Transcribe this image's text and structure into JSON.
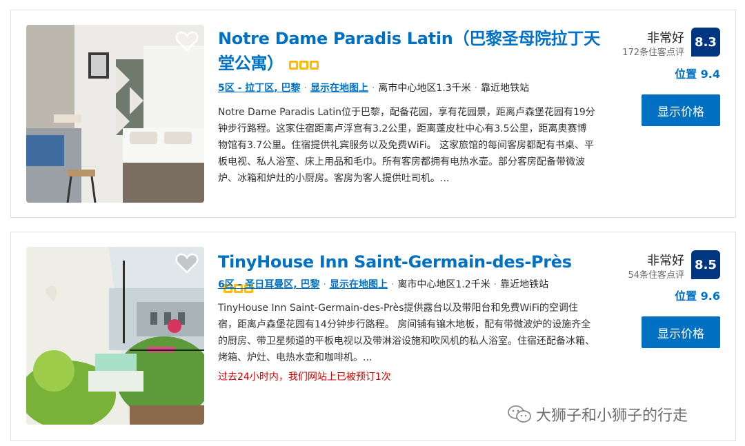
{
  "listings": [
    {
      "title": "Notre Dame Paradis Latin（巴黎圣母院拉丁天堂公寓）",
      "stars": 3,
      "district_link": "5区 - 拉丁区, 巴黎",
      "map_link": "显示在地图上",
      "distance": "离市中心地区1.3千米",
      "metro": "靠近地铁站",
      "description": "Notre Dame Paradis Latin位于巴黎，配备花园，享有花园景，距离卢森堡花园有19分钟步行路程。这家住宿距离卢浮宫有3.2公里，距离蓬皮杜中心有3.5公里，距离奥赛博物馆有3.7公里。住宿提供礼宾服务以及免费WiFi。 这家旅馆的每间客房都配有书桌、平板电视、私人浴室、床上用品和毛巾。所有客房都拥有电热水壶。部分客房配备带微波炉、冰箱和炉灶的小厨房。客房为客人提供吐司机。...",
      "score_word": "非常好",
      "reviews": "172条住客点评",
      "score": "8.3",
      "location": "位置 9.4",
      "button": "显示价格"
    },
    {
      "title": "TinyHouse Inn Saint-Germain-des-Près",
      "stars": 3,
      "district_link": "6区 - 圣日耳曼区, 巴黎",
      "map_link": "显示在地图上",
      "distance": "离市中心地区1.2千米",
      "metro": "靠近地铁站",
      "description": "TinyHouse Inn Saint-Germain-des-Près提供露台以及带阳台和免费WiFi的空调住宿，距离卢森堡花园有14分钟步行路程。 房间铺有镶木地板，配有带微波炉的设施齐全的厨房、带卫星频道的平板电视以及带淋浴设施和吹风机的私人浴室。住宿还配备冰箱、烤箱、炉灶、电热水壶和咖啡机。...",
      "booked_notice": "过去24小时内，我们网站上已被预订1次",
      "score_word": "非常好",
      "reviews": "54条住客点评",
      "score": "8.5",
      "location": "位置 9.6",
      "button": "显示价格"
    }
  ],
  "watermark": "大狮子和小狮子的行走",
  "colors": {
    "link_blue": "#0071c2",
    "score_navy": "#003580",
    "star_yellow": "#febb02",
    "booked_red": "#cc0000"
  }
}
